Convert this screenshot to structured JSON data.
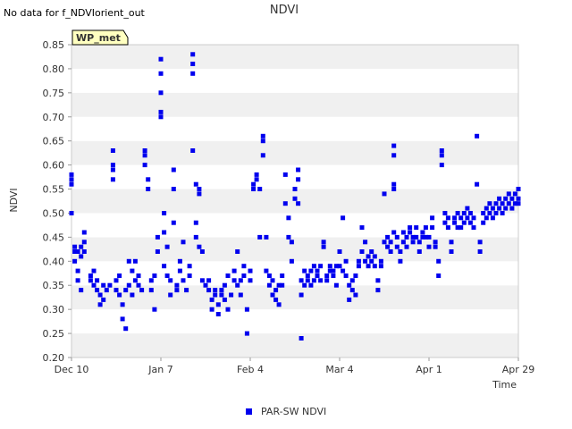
{
  "notice": "No data for f_NDVIorient_out",
  "chart_data": {
    "type": "scatter",
    "title": "NDVI",
    "xlabel": "Time",
    "ylabel": "NDVI",
    "site_badge": "WP_met",
    "x_ticks": [
      "Dec 10",
      "Jan 7",
      "Feb 4",
      "Mar 4",
      "Apr 1",
      "Apr 29"
    ],
    "x_range": [
      "Dec 10",
      "Apr 29"
    ],
    "ylim": [
      0.2,
      0.85
    ],
    "y_ticks": [
      "0.20",
      "0.25",
      "0.30",
      "0.35",
      "0.40",
      "0.45",
      "0.50",
      "0.55",
      "0.60",
      "0.65",
      "0.70",
      "0.75",
      "0.80",
      "0.85"
    ],
    "grid": "alternating horizontal bands",
    "legend_position": "bottom-center",
    "colors": {
      "series": "#0000ee",
      "band": "#f0f0f0",
      "badge_fill": "#ffffc0",
      "badge_text": "#8b0000"
    },
    "series": [
      {
        "name": "PAR-SW NDVI",
        "points": [
          [
            0,
            0.5
          ],
          [
            0,
            0.56
          ],
          [
            0,
            0.57
          ],
          [
            0,
            0.58
          ],
          [
            1,
            0.43
          ],
          [
            1,
            0.42
          ],
          [
            1,
            0.4
          ],
          [
            2,
            0.38
          ],
          [
            2,
            0.36
          ],
          [
            2,
            0.42
          ],
          [
            3,
            0.34
          ],
          [
            3,
            0.43
          ],
          [
            3,
            0.41
          ],
          [
            4,
            0.44
          ],
          [
            4,
            0.46
          ],
          [
            4,
            0.42
          ],
          [
            6,
            0.37
          ],
          [
            6,
            0.36
          ],
          [
            7,
            0.38
          ],
          [
            7,
            0.35
          ],
          [
            8,
            0.34
          ],
          [
            8,
            0.36
          ],
          [
            9,
            0.31
          ],
          [
            9,
            0.33
          ],
          [
            10,
            0.35
          ],
          [
            10,
            0.32
          ],
          [
            11,
            0.34
          ],
          [
            12,
            0.35
          ],
          [
            13,
            0.6
          ],
          [
            13,
            0.57
          ],
          [
            13,
            0.63
          ],
          [
            13,
            0.59
          ],
          [
            14,
            0.36
          ],
          [
            14,
            0.34
          ],
          [
            15,
            0.33
          ],
          [
            15,
            0.37
          ],
          [
            16,
            0.31
          ],
          [
            16,
            0.28
          ],
          [
            17,
            0.26
          ],
          [
            17,
            0.34
          ],
          [
            18,
            0.35
          ],
          [
            18,
            0.4
          ],
          [
            19,
            0.38
          ],
          [
            19,
            0.33
          ],
          [
            20,
            0.36
          ],
          [
            20,
            0.4
          ],
          [
            21,
            0.35
          ],
          [
            21,
            0.37
          ],
          [
            22,
            0.34
          ],
          [
            23,
            0.6
          ],
          [
            23,
            0.63
          ],
          [
            23,
            0.62
          ],
          [
            24,
            0.57
          ],
          [
            24,
            0.55
          ],
          [
            25,
            0.36
          ],
          [
            25,
            0.34
          ],
          [
            26,
            0.3
          ],
          [
            26,
            0.37
          ],
          [
            27,
            0.45
          ],
          [
            27,
            0.42
          ],
          [
            28,
            0.82
          ],
          [
            28,
            0.79
          ],
          [
            28,
            0.75
          ],
          [
            28,
            0.71
          ],
          [
            28,
            0.7
          ],
          [
            29,
            0.5
          ],
          [
            29,
            0.46
          ],
          [
            29,
            0.39
          ],
          [
            30,
            0.43
          ],
          [
            30,
            0.37
          ],
          [
            31,
            0.36
          ],
          [
            31,
            0.33
          ],
          [
            32,
            0.59
          ],
          [
            32,
            0.55
          ],
          [
            32,
            0.48
          ],
          [
            33,
            0.35
          ],
          [
            33,
            0.34
          ],
          [
            34,
            0.4
          ],
          [
            34,
            0.38
          ],
          [
            35,
            0.44
          ],
          [
            35,
            0.36
          ],
          [
            36,
            0.34
          ],
          [
            37,
            0.37
          ],
          [
            37,
            0.39
          ],
          [
            38,
            0.83
          ],
          [
            38,
            0.81
          ],
          [
            38,
            0.79
          ],
          [
            38,
            0.63
          ],
          [
            39,
            0.56
          ],
          [
            39,
            0.48
          ],
          [
            39,
            0.45
          ],
          [
            40,
            0.54
          ],
          [
            40,
            0.55
          ],
          [
            40,
            0.43
          ],
          [
            41,
            0.42
          ],
          [
            41,
            0.36
          ],
          [
            42,
            0.35
          ],
          [
            43,
            0.34
          ],
          [
            43,
            0.36
          ],
          [
            44,
            0.32
          ],
          [
            44,
            0.3
          ],
          [
            45,
            0.33
          ],
          [
            45,
            0.34
          ],
          [
            46,
            0.31
          ],
          [
            46,
            0.29
          ],
          [
            47,
            0.33
          ],
          [
            47,
            0.34
          ],
          [
            48,
            0.35
          ],
          [
            48,
            0.32
          ],
          [
            49,
            0.3
          ],
          [
            49,
            0.37
          ],
          [
            50,
            0.33
          ],
          [
            51,
            0.36
          ],
          [
            51,
            0.38
          ],
          [
            52,
            0.42
          ],
          [
            52,
            0.35
          ],
          [
            53,
            0.33
          ],
          [
            53,
            0.36
          ],
          [
            54,
            0.39
          ],
          [
            54,
            0.37
          ],
          [
            55,
            0.3
          ],
          [
            55,
            0.25
          ],
          [
            56,
            0.36
          ],
          [
            56,
            0.38
          ],
          [
            57,
            0.56
          ],
          [
            57,
            0.55
          ],
          [
            58,
            0.58
          ],
          [
            58,
            0.57
          ],
          [
            59,
            0.55
          ],
          [
            59,
            0.45
          ],
          [
            60,
            0.66
          ],
          [
            60,
            0.65
          ],
          [
            60,
            0.62
          ],
          [
            61,
            0.45
          ],
          [
            61,
            0.38
          ],
          [
            62,
            0.37
          ],
          [
            62,
            0.35
          ],
          [
            63,
            0.33
          ],
          [
            63,
            0.36
          ],
          [
            64,
            0.34
          ],
          [
            64,
            0.32
          ],
          [
            65,
            0.35
          ],
          [
            65,
            0.31
          ],
          [
            66,
            0.37
          ],
          [
            66,
            0.35
          ],
          [
            67,
            0.58
          ],
          [
            67,
            0.52
          ],
          [
            68,
            0.49
          ],
          [
            68,
            0.45
          ],
          [
            69,
            0.44
          ],
          [
            69,
            0.4
          ],
          [
            70,
            0.55
          ],
          [
            70,
            0.53
          ],
          [
            71,
            0.57
          ],
          [
            71,
            0.59
          ],
          [
            71,
            0.52
          ],
          [
            72,
            0.24
          ],
          [
            72,
            0.33
          ],
          [
            72,
            0.36
          ],
          [
            73,
            0.35
          ],
          [
            73,
            0.38
          ],
          [
            74,
            0.36
          ],
          [
            74,
            0.37
          ],
          [
            75,
            0.35
          ],
          [
            75,
            0.38
          ],
          [
            76,
            0.36
          ],
          [
            76,
            0.39
          ],
          [
            77,
            0.38
          ],
          [
            77,
            0.37
          ],
          [
            78,
            0.36
          ],
          [
            78,
            0.39
          ],
          [
            79,
            0.43
          ],
          [
            79,
            0.44
          ],
          [
            80,
            0.37
          ],
          [
            80,
            0.36
          ],
          [
            81,
            0.38
          ],
          [
            81,
            0.39
          ],
          [
            82,
            0.37
          ],
          [
            82,
            0.38
          ],
          [
            83,
            0.35
          ],
          [
            83,
            0.39
          ],
          [
            84,
            0.39
          ],
          [
            84,
            0.42
          ],
          [
            85,
            0.49
          ],
          [
            85,
            0.38
          ],
          [
            86,
            0.4
          ],
          [
            86,
            0.37
          ],
          [
            87,
            0.32
          ],
          [
            87,
            0.35
          ],
          [
            88,
            0.36
          ],
          [
            88,
            0.34
          ],
          [
            89,
            0.37
          ],
          [
            89,
            0.33
          ],
          [
            90,
            0.39
          ],
          [
            90,
            0.4
          ],
          [
            91,
            0.42
          ],
          [
            91,
            0.47
          ],
          [
            92,
            0.4
          ],
          [
            92,
            0.44
          ],
          [
            93,
            0.41
          ],
          [
            93,
            0.39
          ],
          [
            94,
            0.42
          ],
          [
            94,
            0.4
          ],
          [
            95,
            0.39
          ],
          [
            95,
            0.41
          ],
          [
            96,
            0.36
          ],
          [
            96,
            0.34
          ],
          [
            97,
            0.4
          ],
          [
            97,
            0.39
          ],
          [
            98,
            0.54
          ],
          [
            98,
            0.44
          ],
          [
            99,
            0.43
          ],
          [
            99,
            0.45
          ],
          [
            100,
            0.42
          ],
          [
            100,
            0.44
          ],
          [
            101,
            0.46
          ],
          [
            101,
            0.62
          ],
          [
            101,
            0.64
          ],
          [
            101,
            0.55
          ],
          [
            101,
            0.56
          ],
          [
            102,
            0.45
          ],
          [
            102,
            0.43
          ],
          [
            103,
            0.4
          ],
          [
            103,
            0.42
          ],
          [
            104,
            0.46
          ],
          [
            104,
            0.44
          ],
          [
            105,
            0.45
          ],
          [
            105,
            0.43
          ],
          [
            106,
            0.47
          ],
          [
            106,
            0.46
          ],
          [
            107,
            0.45
          ],
          [
            107,
            0.44
          ],
          [
            108,
            0.47
          ],
          [
            108,
            0.45
          ],
          [
            109,
            0.44
          ],
          [
            109,
            0.42
          ],
          [
            110,
            0.46
          ],
          [
            110,
            0.45
          ],
          [
            111,
            0.47
          ],
          [
            111,
            0.45
          ],
          [
            112,
            0.43
          ],
          [
            112,
            0.45
          ],
          [
            113,
            0.47
          ],
          [
            113,
            0.49
          ],
          [
            114,
            0.44
          ],
          [
            114,
            0.43
          ],
          [
            115,
            0.4
          ],
          [
            115,
            0.37
          ],
          [
            116,
            0.62
          ],
          [
            116,
            0.6
          ],
          [
            116,
            0.63
          ],
          [
            117,
            0.5
          ],
          [
            117,
            0.48
          ],
          [
            118,
            0.49
          ],
          [
            118,
            0.47
          ],
          [
            119,
            0.42
          ],
          [
            119,
            0.44
          ],
          [
            120,
            0.48
          ],
          [
            120,
            0.49
          ],
          [
            121,
            0.47
          ],
          [
            121,
            0.5
          ],
          [
            122,
            0.49
          ],
          [
            122,
            0.47
          ],
          [
            123,
            0.48
          ],
          [
            123,
            0.5
          ],
          [
            124,
            0.51
          ],
          [
            124,
            0.49
          ],
          [
            125,
            0.5
          ],
          [
            125,
            0.48
          ],
          [
            126,
            0.49
          ],
          [
            126,
            0.47
          ],
          [
            127,
            0.56
          ],
          [
            127,
            0.66
          ],
          [
            128,
            0.44
          ],
          [
            128,
            0.42
          ],
          [
            129,
            0.5
          ],
          [
            129,
            0.48
          ],
          [
            130,
            0.51
          ],
          [
            130,
            0.49
          ],
          [
            131,
            0.5
          ],
          [
            131,
            0.52
          ],
          [
            132,
            0.51
          ],
          [
            132,
            0.49
          ],
          [
            133,
            0.52
          ],
          [
            133,
            0.5
          ],
          [
            134,
            0.51
          ],
          [
            134,
            0.53
          ],
          [
            135,
            0.52
          ],
          [
            135,
            0.5
          ],
          [
            136,
            0.53
          ],
          [
            136,
            0.51
          ],
          [
            137,
            0.52
          ],
          [
            137,
            0.54
          ],
          [
            138,
            0.53
          ],
          [
            138,
            0.51
          ],
          [
            139,
            0.54
          ],
          [
            139,
            0.52
          ],
          [
            140,
            0.55
          ],
          [
            140,
            0.53
          ],
          [
            140,
            0.52
          ]
        ]
      }
    ]
  }
}
